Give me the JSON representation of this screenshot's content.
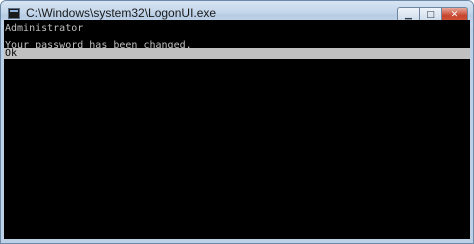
{
  "window": {
    "title": "C:\\Windows\\system32\\LogonUI.exe",
    "controls": {
      "minimize": "▁",
      "maximize": "□",
      "close": "✕"
    }
  },
  "console": {
    "lines": [
      "Administrator",
      "Your password has been changed.",
      "Ok"
    ],
    "text_color": "#c0c0c0",
    "background_color": "#000000",
    "highlight_color": "#c0c0c0"
  }
}
